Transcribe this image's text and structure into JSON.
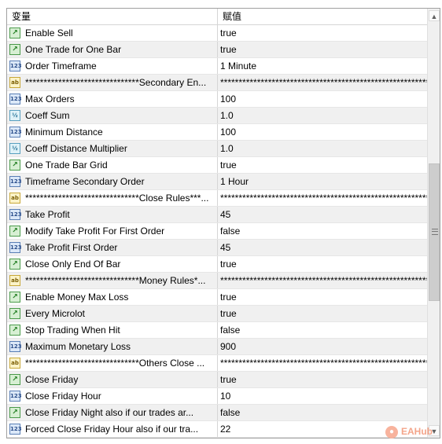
{
  "header": {
    "col_variable": "变量",
    "col_value": "赋值"
  },
  "rows": [
    {
      "icon": "bool",
      "name": "Enable Sell",
      "value": "true"
    },
    {
      "icon": "bool",
      "name": "One Trade for One Bar",
      "value": "true"
    },
    {
      "icon": "num",
      "name": "Order Timeframe",
      "value": "1 Minute"
    },
    {
      "icon": "str",
      "name": "*******************************Secondary En...",
      "value": "************************************************************"
    },
    {
      "icon": "num",
      "name": "Max Orders",
      "value": "100"
    },
    {
      "icon": "dbl",
      "name": "Coeff Sum",
      "value": "1.0"
    },
    {
      "icon": "num",
      "name": "Minimum Distance",
      "value": "100"
    },
    {
      "icon": "dbl",
      "name": "Coeff Distance Multiplier",
      "value": "1.0"
    },
    {
      "icon": "bool",
      "name": "One Trade Bar Grid",
      "value": "true"
    },
    {
      "icon": "num",
      "name": "Timeframe Secondary Order",
      "value": "1 Hour"
    },
    {
      "icon": "str",
      "name": "*******************************Close Rules***...",
      "value": "************************************************************"
    },
    {
      "icon": "num",
      "name": "Take Profit",
      "value": "45"
    },
    {
      "icon": "bool",
      "name": "Modify Take Profit For First Order",
      "value": "false"
    },
    {
      "icon": "num",
      "name": "Take Profit First Order",
      "value": "45"
    },
    {
      "icon": "bool",
      "name": "Close Only End Of Bar",
      "value": "true"
    },
    {
      "icon": "str",
      "name": "*******************************Money Rules*...",
      "value": "************************************************************"
    },
    {
      "icon": "bool",
      "name": "Enable Money Max Loss",
      "value": "true"
    },
    {
      "icon": "bool",
      "name": "Every Microlot",
      "value": "true"
    },
    {
      "icon": "bool",
      "name": "Stop Trading When Hit",
      "value": "false"
    },
    {
      "icon": "num",
      "name": "Maximum Monetary Loss",
      "value": "900"
    },
    {
      "icon": "str",
      "name": "*******************************Others Close ...",
      "value": "************************************************************"
    },
    {
      "icon": "bool",
      "name": "Close Friday",
      "value": "true"
    },
    {
      "icon": "num",
      "name": "Close Friday Hour",
      "value": "10"
    },
    {
      "icon": "bool",
      "name": "Close Friday Night also if our trades ar...",
      "value": "false"
    },
    {
      "icon": "num",
      "name": "Forced Close Friday Hour also if our tra...",
      "value": "22"
    }
  ],
  "icon_glyphs": {
    "bool": "↗",
    "num": "123",
    "dbl": "½",
    "str": "ab"
  },
  "scrollbar": {
    "up": "▲",
    "down": "▼"
  },
  "watermark": {
    "text": "EAHub",
    "glyph": "●"
  }
}
